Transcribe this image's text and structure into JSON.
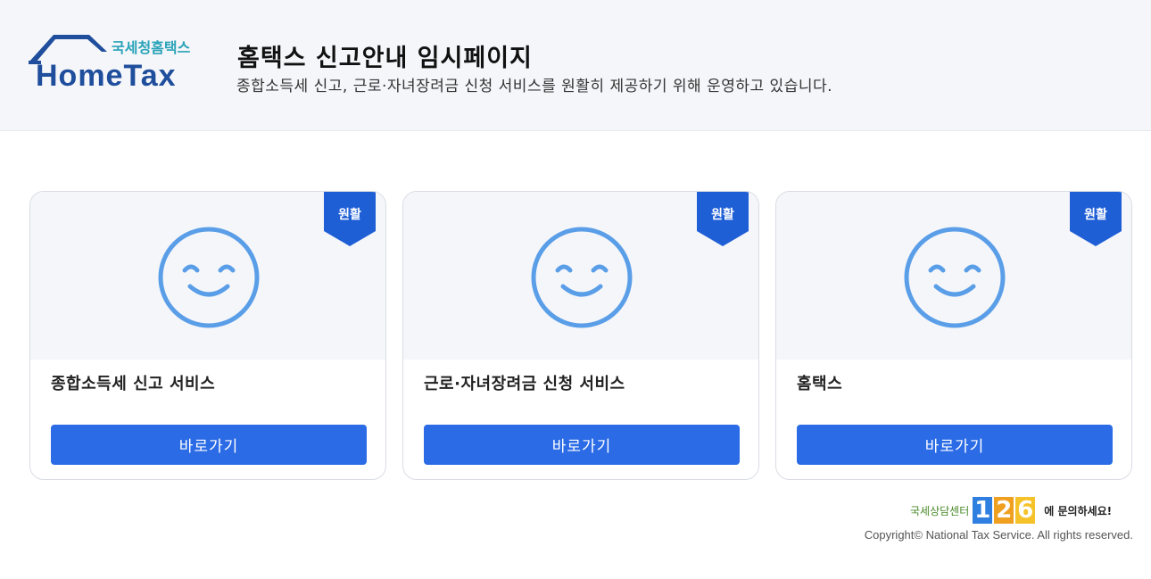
{
  "header": {
    "logo_small": "국세청홈택스",
    "logo_main": "HomeTax",
    "title": "홈택스 신고안내 임시페이지",
    "subtitle": "종합소득세 신고, 근로·자녀장려금 신청 서비스를 원활히 제공하기 위해 운영하고 있습니다."
  },
  "colors": {
    "accent": "#2b6be6",
    "ribbon": "#1f5fd6",
    "smiley": "#5a9ee8",
    "logo_blue": "#1f4e9c",
    "logo_teal": "#2aa3b8"
  },
  "cards": [
    {
      "status": "원활",
      "title": "종합소득세 신고 서비스",
      "button": "바로가기",
      "icon": "smiley-face-icon"
    },
    {
      "status": "원활",
      "title": "근로·자녀장려금 신청 서비스",
      "button": "바로가기",
      "icon": "smiley-face-icon"
    },
    {
      "status": "원활",
      "title": "홈택스",
      "button": "바로가기",
      "icon": "smiley-face-icon"
    }
  ],
  "footer": {
    "callcenter_label": "국세상담센터",
    "callcenter_number": [
      "1",
      "2",
      "6"
    ],
    "callcenter_ask": "에 문의하세요!",
    "copyright": "Copyright© National Tax Service. All rights reserved."
  }
}
